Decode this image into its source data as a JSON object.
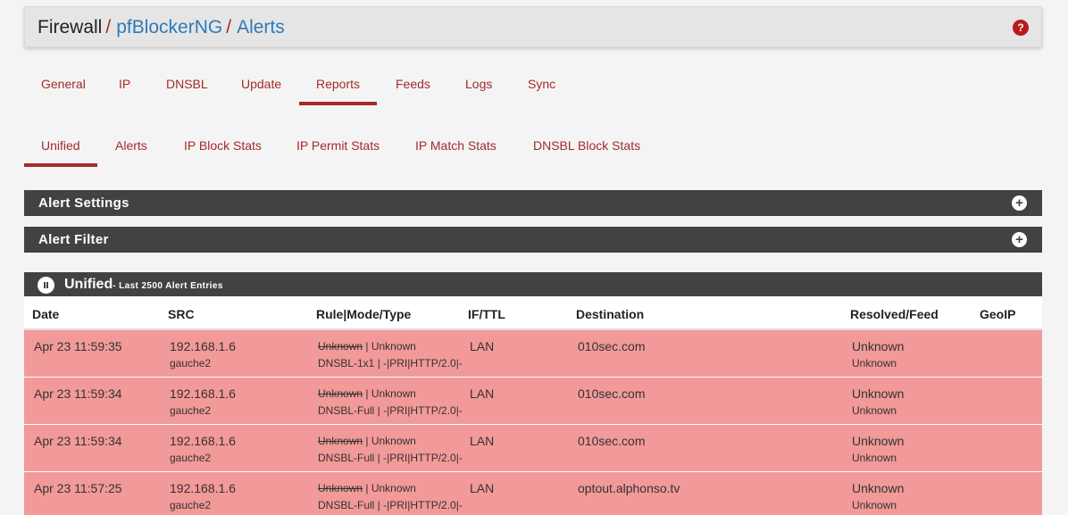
{
  "breadcrumb": {
    "first": "Firewall",
    "separator": "/",
    "second": "pfBlockerNG",
    "third": "Alerts"
  },
  "help_icon": {
    "glyph": "?",
    "color": "#b71c1c"
  },
  "main_tabs": [
    {
      "label": "General",
      "active": false
    },
    {
      "label": "IP",
      "active": false
    },
    {
      "label": "DNSBL",
      "active": false
    },
    {
      "label": "Update",
      "active": false
    },
    {
      "label": "Reports",
      "active": true
    },
    {
      "label": "Feeds",
      "active": false
    },
    {
      "label": "Logs",
      "active": false
    },
    {
      "label": "Sync",
      "active": false
    }
  ],
  "sub_tabs": [
    {
      "label": "Unified",
      "active": true
    },
    {
      "label": "Alerts",
      "active": false
    },
    {
      "label": "IP Block Stats",
      "active": false
    },
    {
      "label": "IP Permit Stats",
      "active": false
    },
    {
      "label": "IP Match Stats",
      "active": false
    },
    {
      "label": "DNSBL Block Stats",
      "active": false
    }
  ],
  "panels": {
    "alert_settings": {
      "title": "Alert Settings",
      "icon": "plus-circle-icon"
    },
    "alert_filter": {
      "title": "Alert Filter",
      "icon": "plus-circle-icon"
    }
  },
  "unified": {
    "title": "Unified",
    "subtitle": "- Last 2500 Alert Entries",
    "icon": "pause-circle-icon"
  },
  "table": {
    "columns": [
      "Date",
      "SRC",
      "Rule|Mode/Type",
      "IF/TTL",
      "Destination",
      "Resolved/Feed",
      "GeoIP"
    ],
    "rows": [
      {
        "date": "Apr 23 11:59:35",
        "src_ip": "192.168.1.6",
        "src_host": "gauche2",
        "rule_struck": "Unknown",
        "rule_rest": " | Unknown",
        "mode_type": "DNSBL-1x1 | -|PRI|HTTP/2.0|-",
        "iface": "LAN",
        "destination": "010sec.com",
        "resolved": "Unknown",
        "feed": "Unknown",
        "geoip": ""
      },
      {
        "date": "Apr 23 11:59:34",
        "src_ip": "192.168.1.6",
        "src_host": "gauche2",
        "rule_struck": "Unknown",
        "rule_rest": " | Unknown",
        "mode_type": "DNSBL-Full | -|PRI|HTTP/2.0|-",
        "iface": "LAN",
        "destination": "010sec.com",
        "resolved": "Unknown",
        "feed": "Unknown",
        "geoip": ""
      },
      {
        "date": "Apr 23 11:59:34",
        "src_ip": "192.168.1.6",
        "src_host": "gauche2",
        "rule_struck": "Unknown",
        "rule_rest": " | Unknown",
        "mode_type": "DNSBL-Full | -|PRI|HTTP/2.0|-",
        "iface": "LAN",
        "destination": "010sec.com",
        "resolved": "Unknown",
        "feed": "Unknown",
        "geoip": ""
      },
      {
        "date": "Apr 23 11:57:25",
        "src_ip": "192.168.1.6",
        "src_host": "gauche2",
        "rule_struck": "Unknown",
        "rule_rest": " | Unknown",
        "mode_type": "DNSBL-Full | -|PRI|HTTP/2.0|-",
        "iface": "LAN",
        "destination": "optout.alphonso.tv",
        "resolved": "Unknown",
        "feed": "Unknown",
        "geoip": ""
      }
    ]
  },
  "colors": {
    "accent": "#a52a2a",
    "link": "#2e7ab8",
    "panel_bg": "#424242",
    "row_alert_bg": "#f29999"
  }
}
